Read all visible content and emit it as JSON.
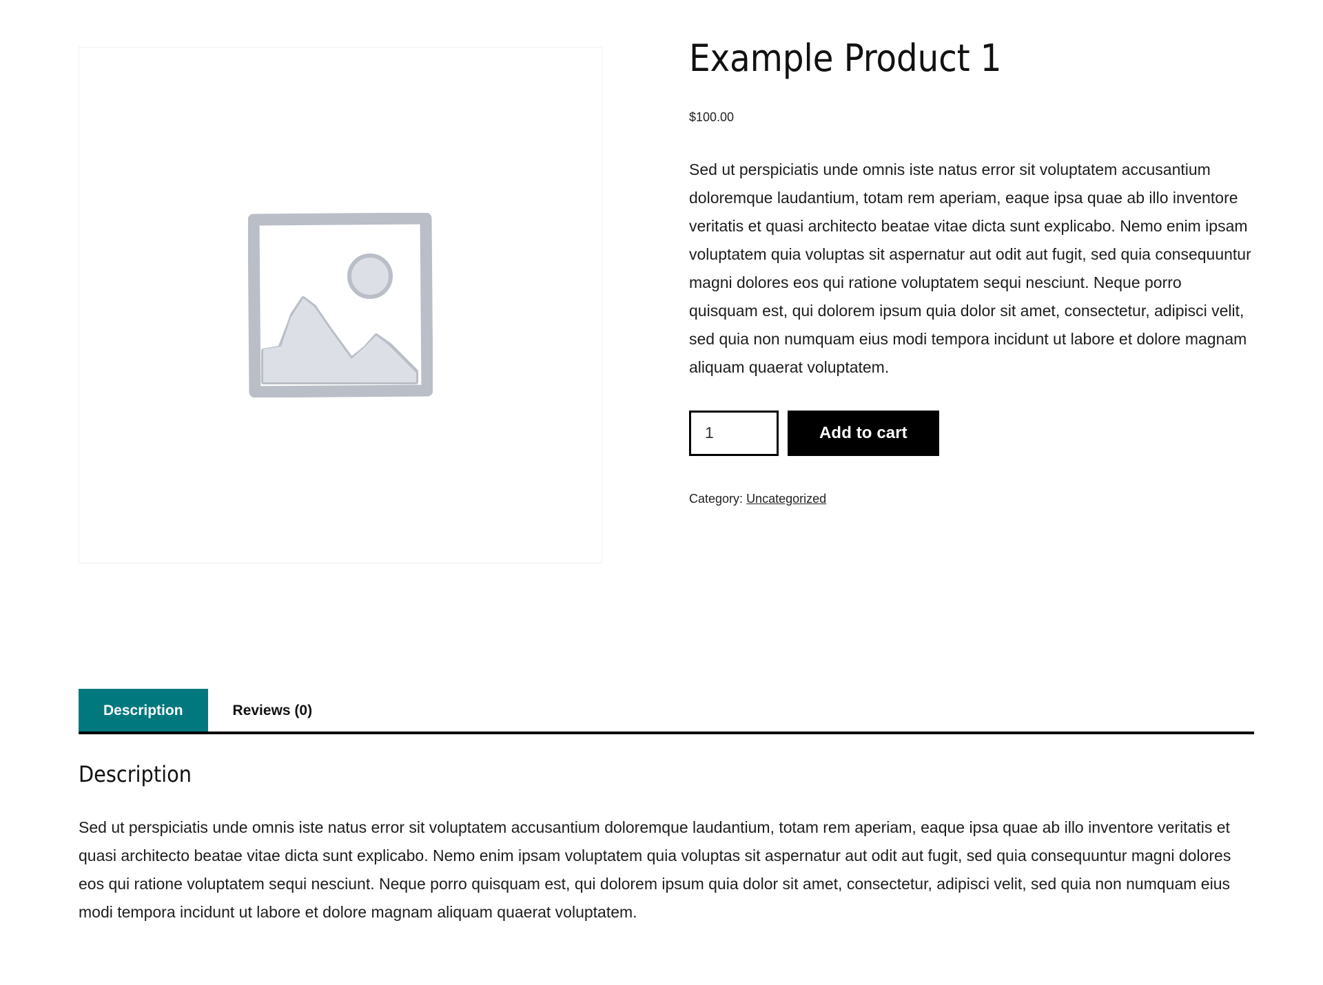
{
  "product": {
    "title": "Example Product 1",
    "price": "$100.00",
    "short_description": "Sed ut perspiciatis unde omnis iste natus error sit voluptatem accusantium doloremque laudantium, totam rem aperiam, eaque ipsa quae ab illo inventore veritatis et quasi architecto beatae vitae dicta sunt explicabo. Nemo enim ipsam voluptatem quia voluptas sit aspernatur aut odit aut fugit, sed quia consequuntur magni dolores eos qui ratione voluptatem sequi nesciunt. Neque porro quisquam est, qui dolorem ipsum quia dolor sit amet, consectetur, adipisci velit, sed quia non numquam eius modi tempora incidunt ut labore et dolore magnam aliquam quaerat voluptatem.",
    "gallery": {
      "image_alt": "placeholder-image",
      "placeholder_stroke": "#b9bec7",
      "placeholder_fill": "#dcdfe5"
    },
    "cart": {
      "quantity_value": "1",
      "quantity_placeholder": "1",
      "add_to_cart_label": "Add to cart",
      "button_bg": "#000000",
      "button_text_color": "#ffffff"
    },
    "meta": {
      "category_label": "Category:",
      "category_value": "Uncategorized"
    }
  },
  "tabs": {
    "active_color": "#00787e",
    "items": [
      {
        "label": "Description",
        "active": true
      },
      {
        "label": "Reviews (0)",
        "active": false
      }
    ]
  },
  "panel": {
    "heading": "Description",
    "body": "Sed ut perspiciatis unde omnis iste natus error sit voluptatem accusantium doloremque laudantium, totam rem aperiam, eaque ipsa quae ab illo inventore veritatis et quasi architecto beatae vitae dicta sunt explicabo. Nemo enim ipsam voluptatem quia voluptas sit aspernatur aut odit aut fugit, sed quia consequuntur magni dolores eos qui ratione voluptatem sequi nesciunt. Neque porro quisquam est, qui dolorem ipsum quia dolor sit amet, consectetur, adipisci velit, sed quia non numquam eius modi tempora incidunt ut labore et dolore magnam aliquam quaerat voluptatem."
  }
}
